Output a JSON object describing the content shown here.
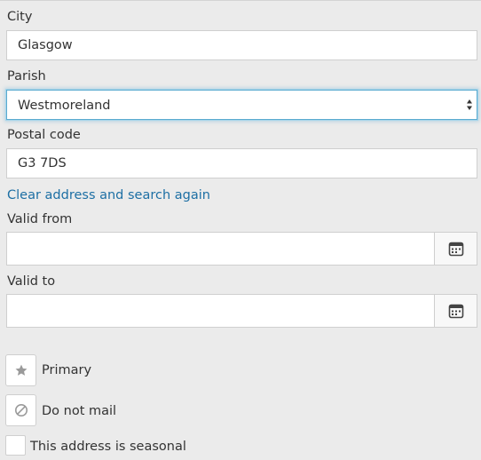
{
  "address": {
    "city_label": "City",
    "city_value": "Glasgow",
    "parish_label": "Parish",
    "parish_value": "Westmoreland",
    "postal_label": "Postal code",
    "postal_value": "G3 7DS",
    "clear_link": "Clear address and search again"
  },
  "validity": {
    "from_label": "Valid from",
    "from_value": "",
    "to_label": "Valid to",
    "to_value": "",
    "calendar_icon": "calendar-icon"
  },
  "options": {
    "primary_label": "Primary",
    "primary_icon": "star-icon",
    "do_not_mail_label": "Do not mail",
    "do_not_mail_icon": "prohibited-icon",
    "seasonal_label": "This address is seasonal",
    "seasonal_checked": false
  },
  "colors": {
    "link": "#1d6fa4",
    "focus": "#5aaad0",
    "background": "#ebebeb"
  }
}
